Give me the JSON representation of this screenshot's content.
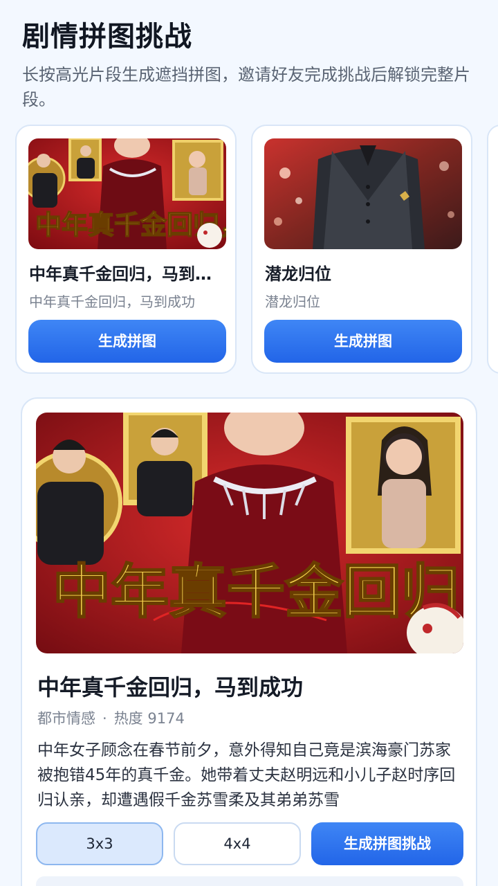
{
  "header": {
    "title": "剧情拼图挑战",
    "subtitle": "长按高光片段生成遮挡拼图，邀请好友完成挑战后解锁完整片段。"
  },
  "carousel": {
    "cards": [
      {
        "title": "中年真千金回归，马到成功",
        "title_display": "中年真千金回归，马到…",
        "subtitle": "中年真千金回归，马到成功",
        "button": "生成拼图",
        "poster_text": "中年真千金回归，"
      },
      {
        "title": "潜龙归位",
        "subtitle": "潜龙归位",
        "button": "生成拼图"
      }
    ]
  },
  "detail": {
    "poster_text": "中年真千金回归，",
    "title": "中年真千金回归，马到成功",
    "genre": "都市情感",
    "separator": "·",
    "heat": "热度 9174",
    "description": "中年女子顾念在春节前夕，意外得知自己竟是滨海豪门苏家被抱错45年的真千金。她带着丈夫赵明远和小儿子赵时序回归认亲，却遭遇假千金苏雪柔及其弟弟苏雪",
    "options": {
      "grid_3": "3x3",
      "grid_4": "4x4",
      "generate": "生成拼图挑战"
    },
    "selected_grid": "3x3"
  },
  "colors": {
    "accent": "#2a6ff0",
    "background": "#f3f8ff",
    "poster_red": "#a8121a",
    "poster_gold": "#e8c24a"
  }
}
